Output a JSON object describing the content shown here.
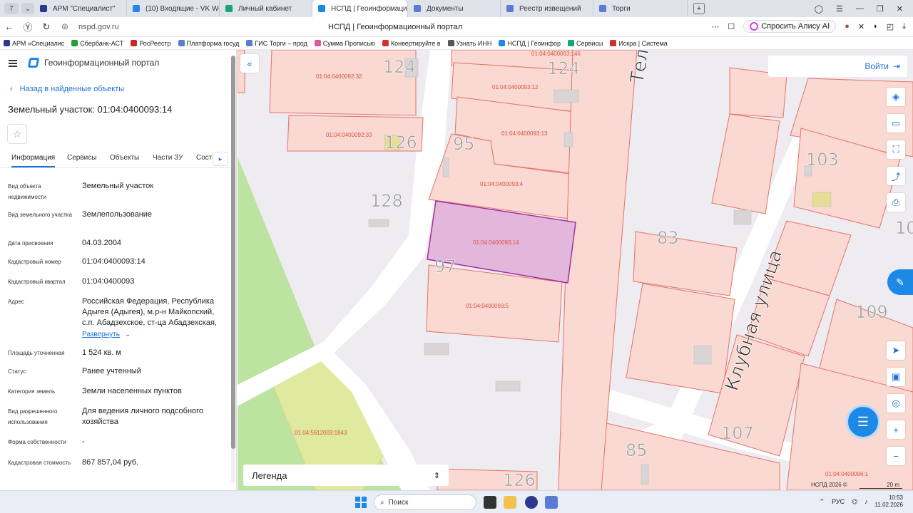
{
  "browser": {
    "tab_count": "7",
    "tabs": [
      {
        "label": "АРМ \"Специалист\"",
        "color": "#2d3a8c"
      },
      {
        "label": "(10) Входящие - VK Workl",
        "color": "#2d7ff9"
      },
      {
        "label": "Личный кабинет",
        "color": "#1aa37a"
      },
      {
        "label": "НСПД | Геоинформацио",
        "color": "#1e88e5",
        "active": true
      },
      {
        "label": "Документы",
        "color": "#5b7bd5"
      },
      {
        "label": "Реестр извещений",
        "color": "#5b7bd5"
      },
      {
        "label": "Торги",
        "color": "#5b7bd5"
      }
    ],
    "new_tab": "+",
    "url": "nspd.gov.ru",
    "page_title": "НСПД | Геоинформационный портал",
    "alisa": "Спросить Алису AI",
    "bookmarks": [
      {
        "label": "АРМ «Специалис",
        "color": "#2d3a8c"
      },
      {
        "label": "Сбербанк-АСТ",
        "color": "#21a038"
      },
      {
        "label": "РосРеестр",
        "color": "#c62828"
      },
      {
        "label": "Платформа госуд",
        "color": "#5b7bd5"
      },
      {
        "label": "ГИС Торги – прод",
        "color": "#5b7bd5"
      },
      {
        "label": "Сумма Прописью",
        "color": "#e056a0"
      },
      {
        "label": "Конвертируйте в",
        "color": "#d32f2f"
      },
      {
        "label": "Узнать ИНН",
        "color": "#555555"
      },
      {
        "label": "НСПД | Геоинфор",
        "color": "#1e88e5"
      },
      {
        "label": "Сервисы",
        "color": "#1aa37a"
      },
      {
        "label": "Искра | Система",
        "color": "#d32f2f"
      }
    ]
  },
  "panel": {
    "app_name": "Геоинформационный портал",
    "back_link": "Назад в найденные объекты",
    "title": "Земельный участок: 01:04:0400093:14",
    "star": "☆",
    "tabs": [
      "Информация",
      "Сервисы",
      "Объекты",
      "Части ЗУ",
      "Соста"
    ],
    "fields": [
      {
        "label": "Вид объекта недвижимости",
        "value": "Земельный участок"
      },
      {
        "label": "Вид земельного участка",
        "value": "Землепользование"
      },
      {
        "label": "Дата присвоения",
        "value": "04.03.2004"
      },
      {
        "label": "Кадастровый номер",
        "value": "01:04:0400093:14"
      },
      {
        "label": "Кадастровый квартал",
        "value": "01:04:0400093"
      },
      {
        "label": "Адрес",
        "value": "Российская Федерация, Республика Адыгея (Адыгея), м.р-н Майкопский, с.п. Абадзехское, ст-ца Абадзехская,"
      },
      {
        "label": "Площадь уточненная",
        "value": "1 524 кв. м"
      },
      {
        "label": "Статус",
        "value": "Ранее учтенный"
      },
      {
        "label": "Категория земель",
        "value": "Земли населенных пунктов"
      },
      {
        "label": "Вид разрешенного использования",
        "value": "Для ведения личного подсобного хозяйства"
      },
      {
        "label": "Форма собственности",
        "value": "-"
      },
      {
        "label": "Кадастровая стоимость",
        "value": "867 857,04 руб."
      }
    ],
    "expand": "Развернуть"
  },
  "map": {
    "login": "Войти",
    "legend": "Легенда",
    "copyright": "НСПД 2026 ©",
    "scale": "20 m",
    "street_1": "Клубная улица",
    "street_2": "Тел",
    "parcels": {
      "p1": "01:04:0400092:32",
      "p2": "01:04:0400092:33",
      "p3": "01:04:0400093:146",
      "p4": "01:04:0400093:12",
      "p5": "01:04:0400093:13",
      "p6": "01:04:0400093:4",
      "p7": "01:04:0400093:14",
      "p8": "01:04:0400093:5",
      "p9": "01:04:5612003:1843",
      "p10": "01:04:0400096:1"
    },
    "houses": {
      "h124a": "124",
      "h124b": "124",
      "h126": "126",
      "h95": "95",
      "h128": "128",
      "h97": "97",
      "h83": "83",
      "h103": "103",
      "h109": "109",
      "h107": "107",
      "h85": "85",
      "h126b": "126",
      "h10": "10"
    },
    "colors": {
      "selected": "#e3b6dc",
      "selected_border": "#a030a0",
      "parcel": "#f9d9d2",
      "parcel_border": "#e57368",
      "green": "#bde3a1"
    }
  },
  "taskbar": {
    "search": "Поиск",
    "lang": "РУС",
    "time": "10:53",
    "date": "11.02.2026"
  }
}
